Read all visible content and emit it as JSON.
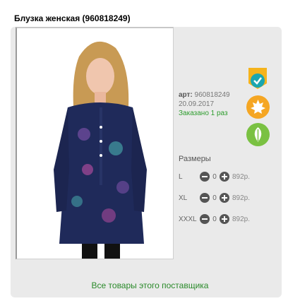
{
  "product": {
    "title": "Блузка женская (960818249)",
    "art_label": "арт:",
    "art_value": "960818249",
    "date": "20.09.2017",
    "ordered": "Заказано 1 раз"
  },
  "badges": [
    {
      "name": "check-icon",
      "color": "#1aa6b0"
    },
    {
      "name": "maple-leaf-icon",
      "color": "#f5a623"
    },
    {
      "name": "leaf-icon",
      "color": "#7ac142"
    }
  ],
  "sizes": {
    "title": "Размеры",
    "rows": [
      {
        "size": "L",
        "qty": "0",
        "price": "892р."
      },
      {
        "size": "XL",
        "qty": "0",
        "price": "892р."
      },
      {
        "size": "XXXL",
        "qty": "0",
        "price": "892р."
      }
    ]
  },
  "footer": {
    "supplier_link": "Все товары этого поставщика"
  },
  "colors": {
    "accent_green": "#2c9c2c",
    "card_bg": "#eaeaea"
  }
}
